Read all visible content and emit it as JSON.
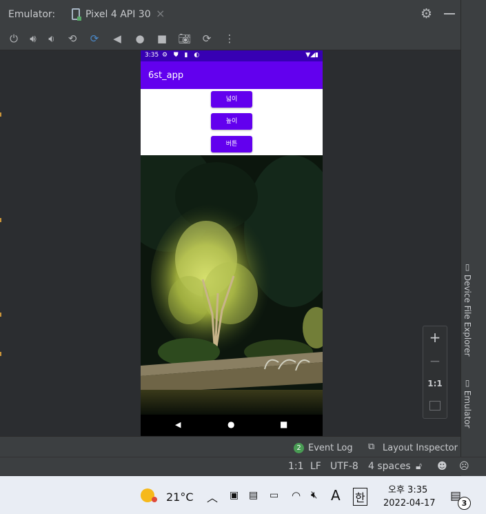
{
  "window": {
    "emulator_label": "Emulator:",
    "device_tab": "Pixel 4 API 30",
    "tab_close": "×",
    "side_tabs": [
      "Device File Explorer",
      "Emulator"
    ]
  },
  "toolbar_icons": [
    "power-icon",
    "volume-up-icon",
    "volume-down-icon",
    "rotate-left-icon",
    "rotate-right-icon",
    "back-icon",
    "home-icon",
    "overview-icon",
    "camera-icon",
    "snapshot-icon",
    "more-icon"
  ],
  "phone": {
    "status_time": "3:35",
    "app_title": "6st_app",
    "buttons": [
      "넓이",
      "높이",
      "버튼"
    ],
    "colors": {
      "primary": "#6200ee",
      "status": "#3700b3"
    }
  },
  "zoom_panel": {
    "zoom_in": "+",
    "zoom_out": "−",
    "actual_size": "1:1"
  },
  "tool_windows": {
    "event_log_count": "2",
    "event_log": "Event Log",
    "layout_inspector": "Layout Inspector"
  },
  "status_bar": {
    "position": "1:1",
    "line_sep": "LF",
    "encoding": "UTF-8",
    "indent": "4 spaces"
  },
  "taskbar": {
    "temperature": "21°C",
    "ime_letter": "A",
    "ime_lang": "한",
    "time": "오후 3:35",
    "date": "2022-04-17",
    "notification_count": "3"
  }
}
